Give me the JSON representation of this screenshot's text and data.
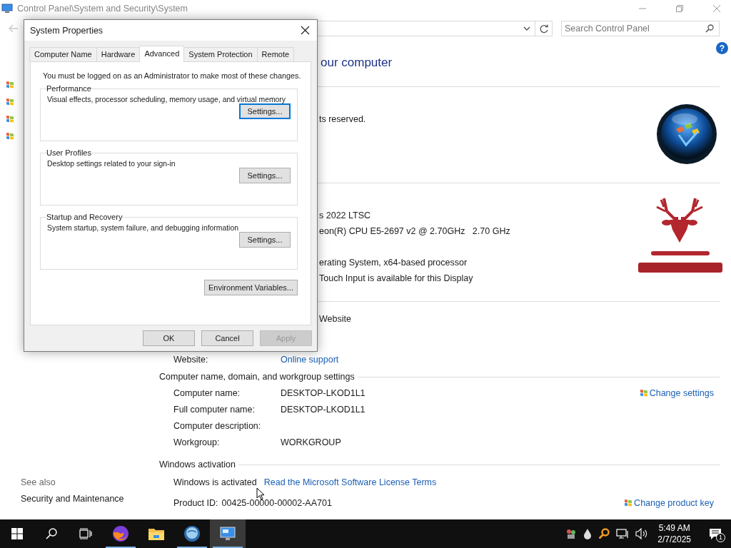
{
  "window": {
    "title": "Control Panel\\System and Security\\System",
    "search_placeholder": "Search Control Panel",
    "help": "?"
  },
  "sidebar": {
    "items": [
      {
        "kind": "flag"
      },
      {
        "kind": "flag"
      },
      {
        "kind": "flag"
      },
      {
        "kind": "flag"
      }
    ],
    "see_also": "See also",
    "links": [
      "Security and Maintenance"
    ]
  },
  "main": {
    "heading": "our computer",
    "edition_text": "ts reserved.",
    "system_groups": [
      {
        "lines": [
          "s 2022 LTSC",
          "eon(R) CPU E5-2697 v2 @ 2.70GHz   2.70 GHz"
        ]
      },
      {
        "lines": [
          "erating System, x64-based processor",
          "Touch Input is available for this Display"
        ]
      }
    ],
    "support_title": "Website",
    "support_rows": [
      {
        "label": "Website:",
        "value": "Online support"
      }
    ],
    "computer_section": {
      "title": "Computer name, domain, and workgroup settings",
      "link": "Change settings",
      "rows": [
        {
          "label": "Computer name:",
          "value": "DESKTOP-LKOD1L1"
        },
        {
          "label": "Full computer name:",
          "value": "DESKTOP-LKOD1L1"
        },
        {
          "label": "Computer description:"
        },
        {
          "label": "Workgroup:",
          "value": "WORKGROUP"
        }
      ]
    },
    "activation": {
      "title": "Windows activation",
      "status": "Windows is activated",
      "license_link": "Read the Microsoft Software License Terms",
      "product_id_label": "Product ID:",
      "product_id": "00425-00000-00002-AA701",
      "link": "Change product key"
    }
  },
  "dialog": {
    "title": "System Properties",
    "tabs": [
      {
        "label": "Computer Name",
        "selected": false
      },
      {
        "label": "Hardware",
        "selected": false
      },
      {
        "label": "Advanced",
        "selected": true
      },
      {
        "label": "System Protection",
        "selected": false
      },
      {
        "label": "Remote",
        "selected": false
      }
    ],
    "notice": "You must be logged on as an Administrator to make most of these changes.",
    "groups": [
      {
        "title": "Performance",
        "description": "Visual effects, processor scheduling, memory usage, and virtual memory",
        "button": "Settings...",
        "focused": true
      },
      {
        "title": "User Profiles",
        "description": "Desktop settings related to your sign-in",
        "button": "Settings...",
        "focused": false
      },
      {
        "title": "Startup and Recovery",
        "description": "System startup, system failure, and debugging information",
        "button": "Settings...",
        "focused": false
      }
    ],
    "env_button": "Environment Variables...",
    "buttons": [
      {
        "label": "OK",
        "disabled": false
      },
      {
        "label": "Cancel",
        "disabled": false
      },
      {
        "label": "Apply",
        "disabled": true
      }
    ]
  },
  "taskbar": {
    "apps": [
      {
        "kind": "browser",
        "running": true,
        "selected": false
      },
      {
        "kind": "folder",
        "running": false,
        "selected": false
      },
      {
        "kind": "globe",
        "running": true,
        "selected": false
      },
      {
        "kind": "monitor",
        "running": true,
        "selected": true
      }
    ],
    "time": "5:49 AM",
    "date": "2/7/2025",
    "notifications": "1"
  }
}
